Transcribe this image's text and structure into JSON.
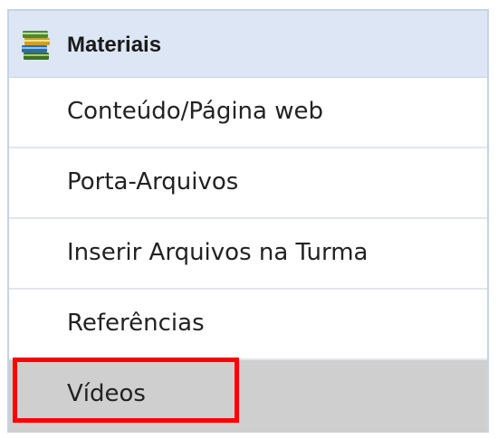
{
  "panel": {
    "title": "Materiais",
    "icon": "books-stack-icon"
  },
  "menu": {
    "items": [
      {
        "label": "Conteúdo/Página web"
      },
      {
        "label": "Porta-Arquivos"
      },
      {
        "label": "Inserir Arquivos na Turma"
      },
      {
        "label": "Referências"
      },
      {
        "label": "Vídeos",
        "selected": true
      }
    ]
  },
  "colors": {
    "header_background": "#dce6f4",
    "selected_background": "#cfcfcf",
    "highlight_border": "#ff0000"
  }
}
